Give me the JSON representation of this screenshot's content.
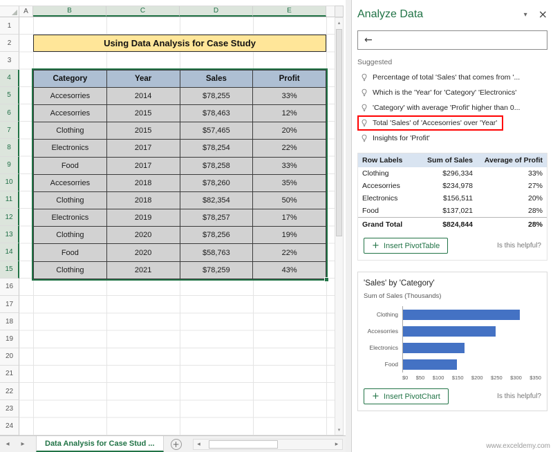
{
  "colors": {
    "excel_green": "#217346",
    "bar_blue": "#4472C4",
    "title_cell_bg": "#FFE699",
    "table_header_bg": "#AEBFD3",
    "table_cell_bg": "#D2D2D2",
    "highlight_red": "#FF0000"
  },
  "icons": {
    "plus": "+",
    "close": "×",
    "pane_options": "▾",
    "back": "←",
    "up_arrow": "▴",
    "down_arrow": "▾",
    "left_arrow": "◂",
    "right_arrow": "▸"
  },
  "grid": {
    "columns": [
      {
        "label": "A",
        "width": 20
      },
      {
        "label": "B",
        "width": 106
      },
      {
        "label": "C",
        "width": 106
      },
      {
        "label": "D",
        "width": 106
      },
      {
        "label": "E",
        "width": 106
      }
    ],
    "selected_columns": [
      "B",
      "C",
      "D",
      "E"
    ],
    "row_count": 24,
    "selected_rows": {
      "from": 4,
      "to": 15
    },
    "selected_range": "B4:E15"
  },
  "worksheet": {
    "title": "Using Data Analysis for Case Study",
    "table": {
      "headers": [
        "Category",
        "Year",
        "Sales",
        "Profit"
      ],
      "rows": [
        [
          "Accesorries",
          "2014",
          "$78,255",
          "33%"
        ],
        [
          "Accesorries",
          "2015",
          "$78,463",
          "12%"
        ],
        [
          "Clothing",
          "2015",
          "$57,465",
          "20%"
        ],
        [
          "Electronics",
          "2017",
          "$78,254",
          "22%"
        ],
        [
          "Food",
          "2017",
          "$78,258",
          "33%"
        ],
        [
          "Accesorries",
          "2018",
          "$78,260",
          "35%"
        ],
        [
          "Clothing",
          "2018",
          "$82,354",
          "50%"
        ],
        [
          "Electronics",
          "2019",
          "$78,257",
          "17%"
        ],
        [
          "Clothing",
          "2020",
          "$78,256",
          "19%"
        ],
        [
          "Food",
          "2020",
          "$58,763",
          "22%"
        ],
        [
          "Clothing",
          "2021",
          "$78,259",
          "43%"
        ]
      ]
    }
  },
  "sheet_tabs": {
    "active_label": "Data Analysis for Case Stud ..."
  },
  "pane": {
    "title": "Analyze Data",
    "suggested_label": "Suggested",
    "suggestions": [
      "Percentage of total 'Sales' that comes from '...",
      "Which is the 'Year' for 'Category' 'Electronics'",
      "'Category' with average 'Profit' higher than 0...",
      "Total 'Sales' of 'Accesorries' over 'Year'",
      "Insights for 'Profit'"
    ],
    "highlighted_suggestion_index": 3,
    "pivot": {
      "headers": [
        "Row Labels",
        "Sum of Sales",
        "Average of Profit"
      ],
      "rows": [
        [
          "Clothing",
          "$296,334",
          "33%"
        ],
        [
          "Accesorries",
          "$234,978",
          "27%"
        ],
        [
          "Electronics",
          "$156,511",
          "20%"
        ],
        [
          "Food",
          "$137,021",
          "28%"
        ]
      ],
      "grand_total": [
        "Grand Total",
        "$824,844",
        "28%"
      ],
      "insert_button_label": "Insert PivotTable",
      "helpful_label": "Is this helpful?"
    },
    "chart_section": {
      "insert_button_label": "Insert PivotChart",
      "helpful_label": "Is this helpful?"
    },
    "watermark": "www.exceldemy.com"
  },
  "chart_data": {
    "type": "bar",
    "orientation": "horizontal",
    "title": "'Sales' by 'Category'",
    "subtitle": "Sum of Sales (Thousands)",
    "categories": [
      "Clothing",
      "Accesorries",
      "Electronics",
      "Food"
    ],
    "values": [
      296.334,
      234.978,
      156.511,
      137.021
    ],
    "xlim": [
      0,
      350
    ],
    "x_tick_labels": [
      "$0",
      "$50",
      "$100",
      "$150",
      "$200",
      "$250",
      "$300",
      "$350"
    ],
    "bar_color": "#4472C4",
    "legend": "none",
    "grid": false
  }
}
